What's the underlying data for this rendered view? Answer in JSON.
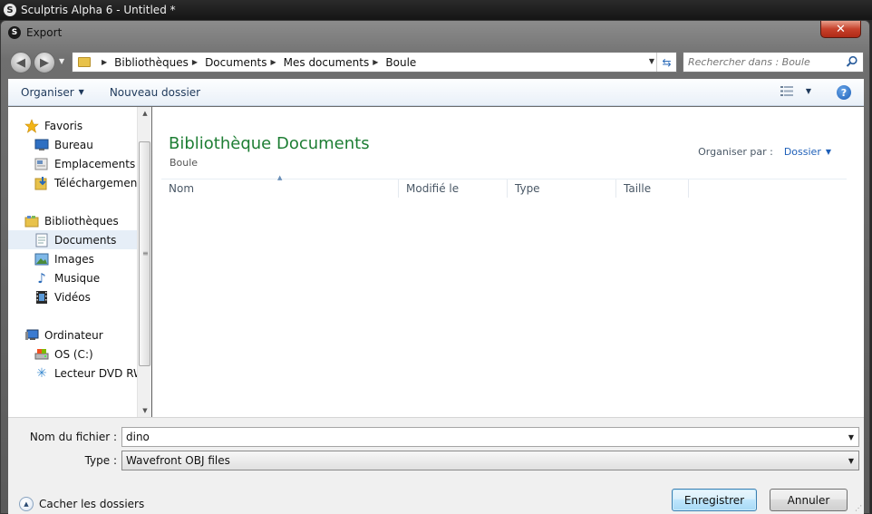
{
  "app": {
    "title": "Sculptris Alpha 6 - Untitled *"
  },
  "dialog": {
    "title": "Export",
    "close_glyph": "✕"
  },
  "address": {
    "crumbs": [
      "Bibliothèques",
      "Documents",
      "Mes documents",
      "Boule"
    ]
  },
  "search": {
    "placeholder": "Rechercher dans : Boule"
  },
  "toolbar": {
    "organize_label": "Organiser",
    "new_folder_label": "Nouveau dossier"
  },
  "navpane": {
    "favorites": {
      "label": "Favoris",
      "items": [
        {
          "label": "Bureau",
          "icon": "desktop-icon"
        },
        {
          "label": "Emplacements ré",
          "icon": "recent-places-icon"
        },
        {
          "label": "Téléchargements",
          "icon": "downloads-icon"
        }
      ]
    },
    "libraries": {
      "label": "Bibliothèques",
      "items": [
        {
          "label": "Documents",
          "icon": "documents-icon",
          "selected": true
        },
        {
          "label": "Images",
          "icon": "images-icon"
        },
        {
          "label": "Musique",
          "icon": "music-icon"
        },
        {
          "label": "Vidéos",
          "icon": "videos-icon"
        }
      ]
    },
    "computer": {
      "label": "Ordinateur",
      "items": [
        {
          "label": "OS (C:)",
          "icon": "drive-icon"
        },
        {
          "label": "Lecteur DVD RW",
          "icon": "dvd-icon"
        }
      ]
    }
  },
  "filepane": {
    "title": "Bibliothèque Documents",
    "subtitle": "Boule",
    "arrange_label": "Organiser par :",
    "arrange_value": "Dossier",
    "columns": [
      "Nom",
      "Modifié le",
      "Type",
      "Taille"
    ]
  },
  "form": {
    "filename_label": "Nom du fichier :",
    "filename_value": "dino",
    "type_label": "Type :",
    "type_value": "Wavefront OBJ files"
  },
  "footer": {
    "hide_folders_label": "Cacher les dossiers",
    "save_label": "Enregistrer",
    "cancel_label": "Annuler"
  },
  "colors": {
    "accent_green": "#1e7e34",
    "link_blue": "#1e5fb8",
    "selection": "#e6eef7"
  }
}
